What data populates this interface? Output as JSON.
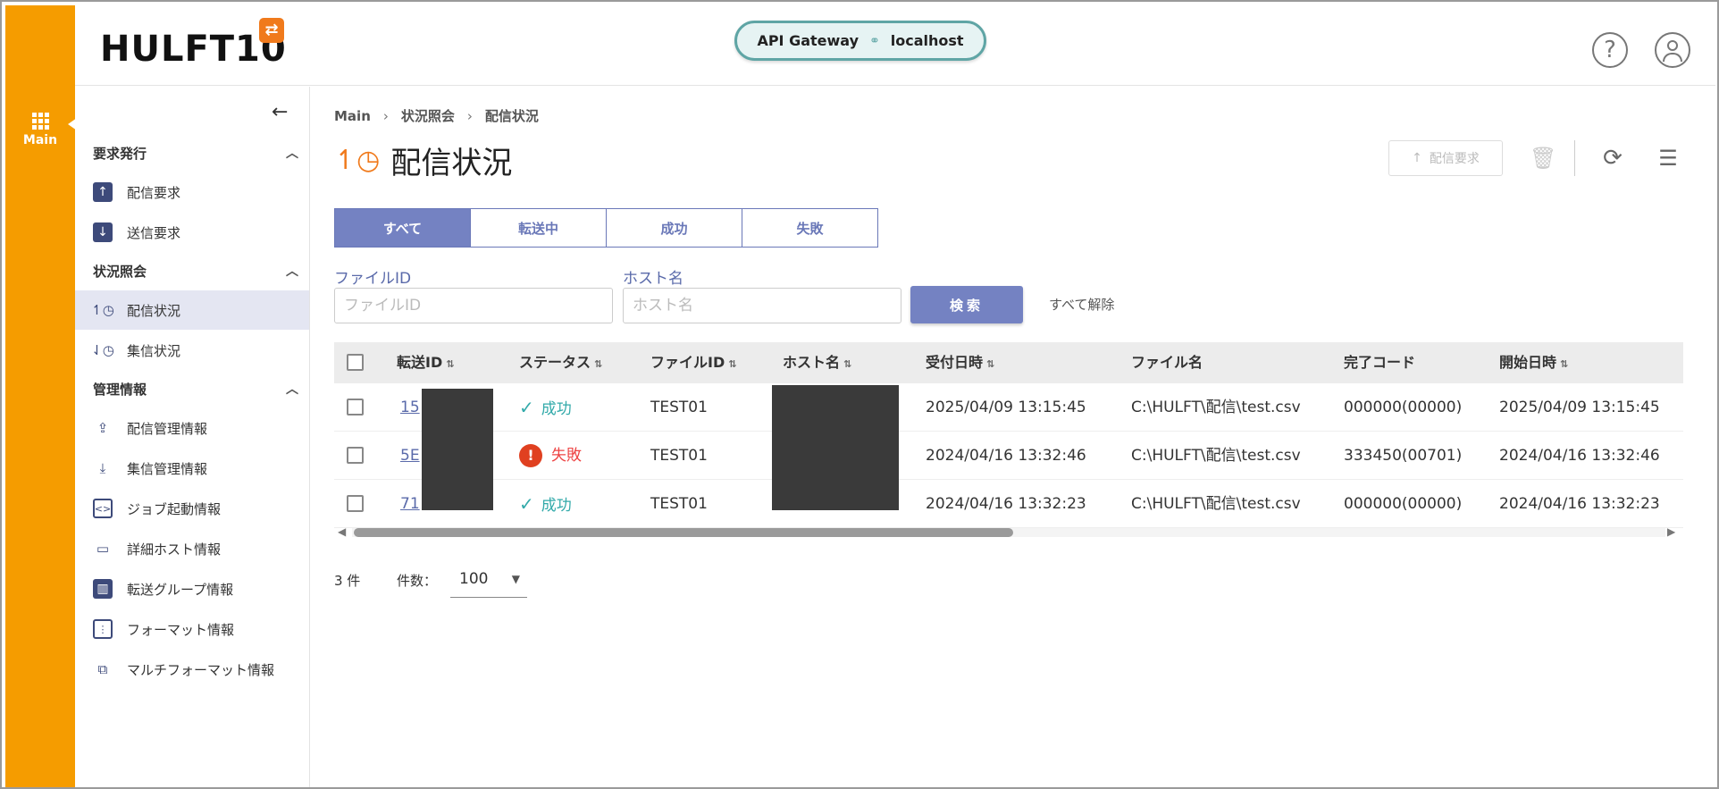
{
  "rail": {
    "main_label": "Main"
  },
  "header": {
    "logo": "HULFT10",
    "logo_badge": "⇄",
    "api_gateway": "API Gateway",
    "host": "localhost"
  },
  "sidebar": {
    "sections": [
      {
        "label": "要求発行",
        "items": [
          {
            "label": "配信要求",
            "icon": "upload-arrow-icon"
          },
          {
            "label": "送信要求",
            "icon": "download-arrow-icon"
          }
        ]
      },
      {
        "label": "状況照会",
        "items": [
          {
            "label": "配信状況",
            "icon": "send-history-icon",
            "active": true
          },
          {
            "label": "集信状況",
            "icon": "receive-history-icon"
          }
        ]
      },
      {
        "label": "管理情報",
        "items": [
          {
            "label": "配信管理情報",
            "icon": "upload-tray-icon"
          },
          {
            "label": "集信管理情報",
            "icon": "download-tray-icon"
          },
          {
            "label": "ジョブ起動情報",
            "icon": "code-icon"
          },
          {
            "label": "詳細ホスト情報",
            "icon": "monitor-icon"
          },
          {
            "label": "転送グループ情報",
            "icon": "group-icon"
          },
          {
            "label": "フォーマット情報",
            "icon": "format-icon"
          },
          {
            "label": "マルチフォーマット情報",
            "icon": "multi-format-icon"
          }
        ]
      }
    ]
  },
  "content": {
    "breadcrumb": [
      "Main",
      "状況照会",
      "配信状況"
    ],
    "title": "配信状況",
    "toolbar": {
      "request_label": "配信要求"
    },
    "tabs": [
      "すべて",
      "転送中",
      "成功",
      "失敗"
    ],
    "filters": {
      "file_id_label": "ファイルID",
      "file_id_placeholder": "ファイルID",
      "host_label": "ホスト名",
      "host_placeholder": "ホスト名",
      "search_label": "検索",
      "clear_label": "すべて解除"
    },
    "table": {
      "columns": [
        "転送ID",
        "ステータス",
        "ファイルID",
        "ホスト名",
        "受付日時",
        "ファイル名",
        "完了コード",
        "開始日時"
      ],
      "rows": [
        {
          "id": "15",
          "status": "成功",
          "status_type": "ok",
          "file_id": "TEST01",
          "received": "2025/04/09 13:15:45",
          "file_name": "C:\\HULFT\\配信\\test.csv",
          "code": "000000(00000)",
          "started": "2025/04/09 13:15:45"
        },
        {
          "id": "5E",
          "status": "失敗",
          "status_type": "ng",
          "file_id": "TEST01",
          "received": "2024/04/16 13:32:46",
          "file_name": "C:\\HULFT\\配信\\test.csv",
          "code": "333450(00701)",
          "started": "2024/04/16 13:32:46"
        },
        {
          "id": "71",
          "status": "成功",
          "status_type": "ok",
          "file_id": "TEST01",
          "received": "2024/04/16 13:32:23",
          "file_name": "C:\\HULFT\\配信\\test.csv",
          "code": "000000(00000)",
          "started": "2024/04/16 13:32:23"
        }
      ]
    },
    "pager": {
      "total": "3 件",
      "count_label": "件数：",
      "page_size": "100"
    }
  }
}
